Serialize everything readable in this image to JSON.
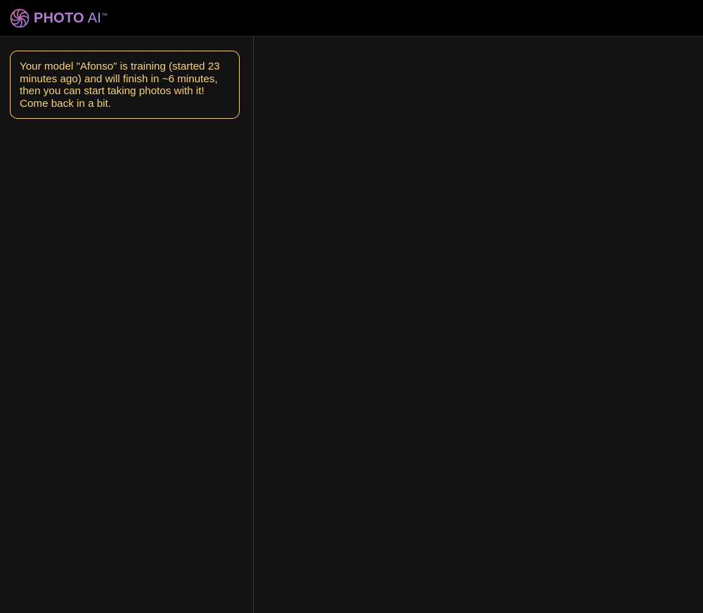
{
  "header": {
    "logo_icon": "swirl-logo-icon",
    "brand_primary": "PHOTO",
    "brand_secondary": "AI",
    "brand_tm": "™",
    "brand_color": "#b57bd6"
  },
  "sidebar": {
    "notice": {
      "text": "Your model \"Afonso\" is training (started 23 minutes ago) and will finish in ~6 minutes, then you can start taking photos with it! Come back in a bit.",
      "border_color": "#f2cc73",
      "text_color": "#f7d27a"
    }
  },
  "colors": {
    "background": "#121212",
    "topbar": "#000000",
    "divider": "#3a3a3a"
  }
}
